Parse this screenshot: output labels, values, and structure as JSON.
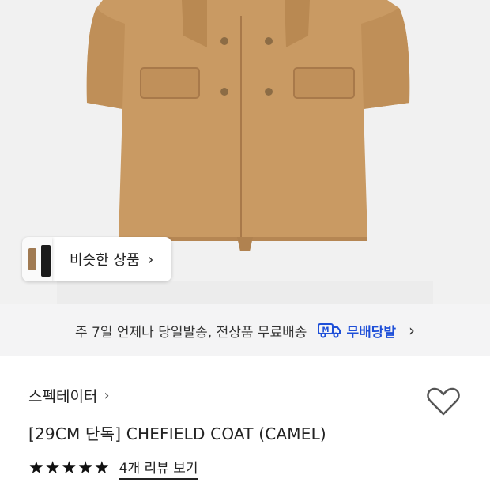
{
  "similar_products": {
    "label": "비슷한 상품",
    "chevron_icon": "chevron-right-icon"
  },
  "delivery": {
    "text": "주 7일 언제나 당일발송, 전상품 무료배송",
    "badge_label": "무배당발",
    "badge_icon": "delivery-truck-icon",
    "badge_color": "#1e4fd8",
    "chevron_icon": "chevron-right-icon"
  },
  "product": {
    "brand": "스펙테이터",
    "title": "[29CM 단독] CHEFIELD COAT (CAMEL)",
    "wishlist_icon": "heart-outline-icon",
    "rating": {
      "stars": 5,
      "max": 5,
      "review_link": "4개 리뷰 보기"
    }
  },
  "colors": {
    "coat": "#c99a63",
    "background": "#f1f1f1",
    "accent": "#1e4fd8"
  }
}
